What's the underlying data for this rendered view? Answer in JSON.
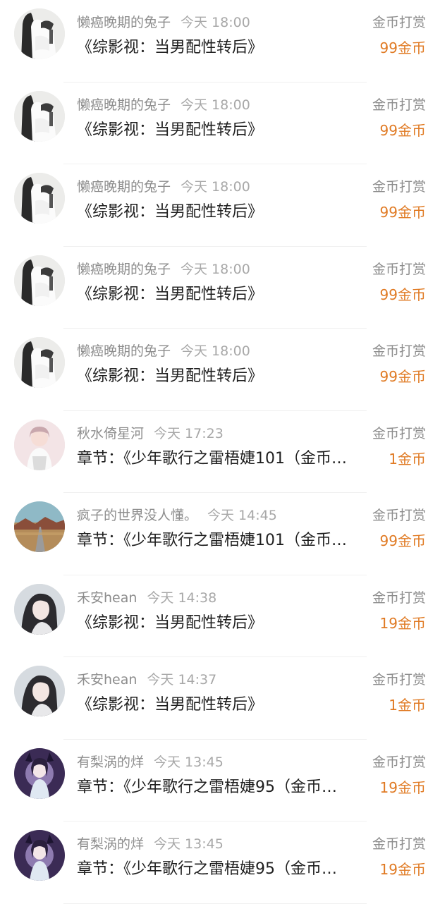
{
  "type_label": "金币打赏",
  "rewards": [
    {
      "user": "懒癌晚期的兔子",
      "time": "今天 18:00",
      "title": "《综影视：当男配性转后》",
      "amount": "99金币",
      "avatar": "rabbit-avatar"
    },
    {
      "user": "懒癌晚期的兔子",
      "time": "今天 18:00",
      "title": "《综影视：当男配性转后》",
      "amount": "99金币",
      "avatar": "rabbit-avatar"
    },
    {
      "user": "懒癌晚期的兔子",
      "time": "今天 18:00",
      "title": "《综影视：当男配性转后》",
      "amount": "99金币",
      "avatar": "rabbit-avatar"
    },
    {
      "user": "懒癌晚期的兔子",
      "time": "今天 18:00",
      "title": "《综影视：当男配性转后》",
      "amount": "99金币",
      "avatar": "rabbit-avatar"
    },
    {
      "user": "懒癌晚期的兔子",
      "time": "今天 18:00",
      "title": "《综影视：当男配性转后》",
      "amount": "99金币",
      "avatar": "rabbit-avatar"
    },
    {
      "user": "秋水倚星河",
      "time": "今天 17:23",
      "title": "章节：《少年歌行之雷梧婕101（金币…",
      "amount": "1金币",
      "avatar": "anime-girl-avatar"
    },
    {
      "user": "疯子的世界没人懂。",
      "time": "今天 14:45",
      "title": "章节：《少年歌行之雷梧婕101（金币…",
      "amount": "99金币",
      "avatar": "landscape-avatar"
    },
    {
      "user": "禾安hean",
      "time": "今天 14:38",
      "title": "《综影视：当男配性转后》",
      "amount": "19金币",
      "avatar": "portrait-avatar"
    },
    {
      "user": "禾安hean",
      "time": "今天 14:37",
      "title": "《综影视：当男配性转后》",
      "amount": "1金币",
      "avatar": "portrait-avatar"
    },
    {
      "user": "有梨涡的烊",
      "time": "今天 13:45",
      "title": "章节：《少年歌行之雷梧婕95（金币…",
      "amount": "19金币",
      "avatar": "purple-anime-avatar"
    },
    {
      "user": "有梨涡的烊",
      "time": "今天 13:45",
      "title": "章节：《少年歌行之雷梧婕95（金币…",
      "amount": "19金币",
      "avatar": "purple-anime-avatar"
    }
  ]
}
